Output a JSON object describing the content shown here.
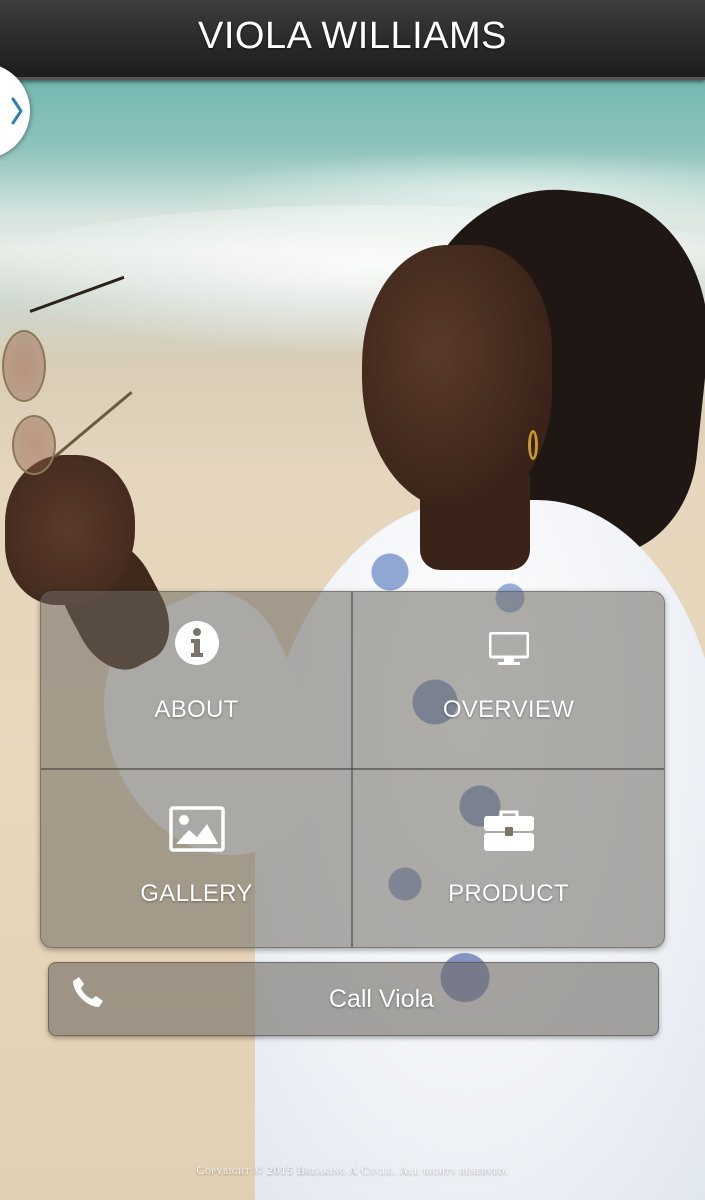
{
  "header": {
    "title": "VIOLA WILLIAMS"
  },
  "side_toggle": {
    "icon": "chevron-right-icon",
    "color": "#2f7fb5"
  },
  "tiles": [
    {
      "label": "ABOUT",
      "icon": "info-circle-icon"
    },
    {
      "label": "OVERVIEW",
      "icon": "desktop-icon"
    },
    {
      "label": "GALLERY",
      "icon": "image-icon"
    },
    {
      "label": "PRODUCT",
      "icon": "briefcase-icon"
    }
  ],
  "call": {
    "label": "Call Viola",
    "icon": "phone-icon"
  },
  "footer": {
    "copyright": "Copyright © 2015 Breaking A Cycle. All rights reserved."
  },
  "colors": {
    "header_bg": "#2a2a2a",
    "tile_overlay": "rgba(110,105,98,0.55)",
    "text": "#ffffff"
  }
}
